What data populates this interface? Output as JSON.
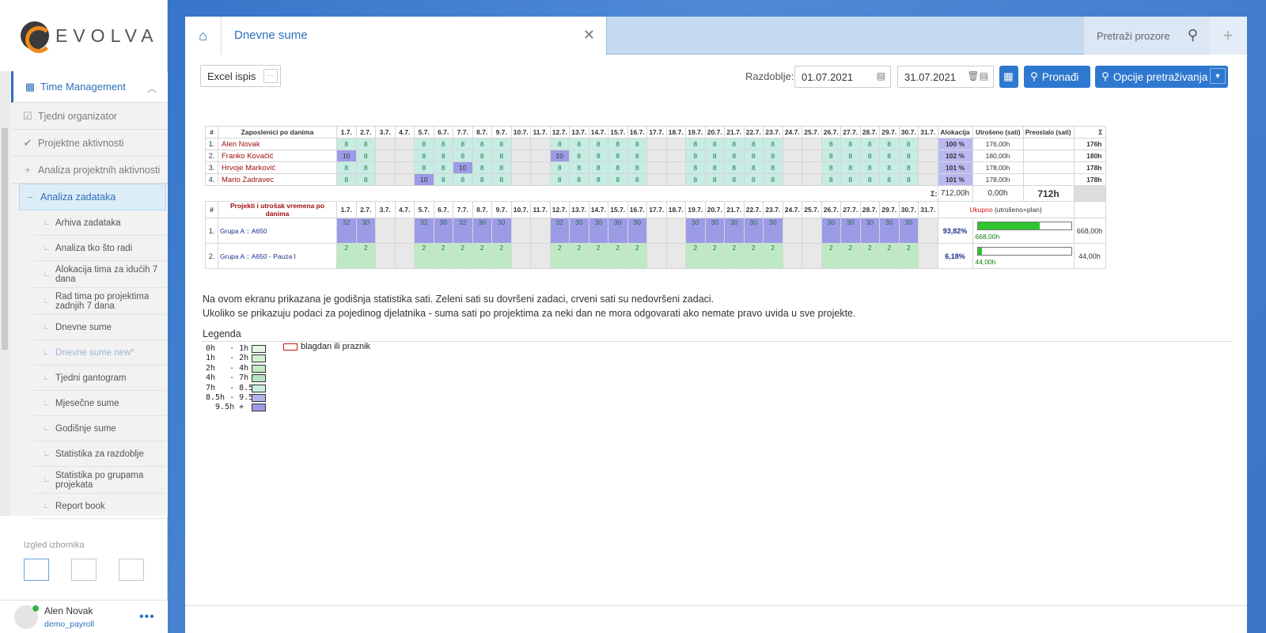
{
  "brand": {
    "name": "EVOLVA"
  },
  "colors": {
    "accent": "#2e6fbd",
    "cell_green": "#c6ece3",
    "cell_purple": "#9b9be6",
    "cell_weekend": "#e8e8e8",
    "cell_project_green": "#bfe9c4"
  },
  "sidebar": {
    "module": "Time Management",
    "items": [
      {
        "label": "Tjedni organizator",
        "icon": "calendar-check-icon"
      },
      {
        "label": "Projektne aktivnosti",
        "icon": "checkmark-icon"
      },
      {
        "label": "Analiza projektnih aktivnosti",
        "icon": "plus-icon"
      },
      {
        "label": "Analiza zadataka",
        "icon": "minus-icon"
      }
    ],
    "subitems": [
      "Arhiva zadataka",
      "Analiza tko što radi",
      "Alokacija tima za idućih 7 dana",
      "Rad tima po projektima zadnjih 7 dana",
      "Dnevne sume",
      "Dnevne sume new*",
      "Tjedni gantogram",
      "Mjesečne sume",
      "Godišnje sume",
      "Statistika za razdoblje",
      "Statistika po grupama projekata",
      "Report book"
    ],
    "layout_label": "Izgled izbornika"
  },
  "user": {
    "name": "Alen Novak",
    "role": "demo_payroll"
  },
  "tabs": {
    "active": "Dnevne sume",
    "search_placeholder": "Pretraži prozore"
  },
  "toolbar": {
    "excel": "Excel ispis",
    "period_label": "Razdoblje:",
    "date_from": "01.07.2021",
    "date_to": "31.07.2021",
    "find": "Pronađi",
    "options": "Opcije pretraživanja"
  },
  "grid": {
    "days": [
      "1.7.",
      "2.7.",
      "3.7.",
      "4.7.",
      "5.7.",
      "6.7.",
      "7.7.",
      "8.7.",
      "9.7.",
      "10.7.",
      "11.7.",
      "12.7.",
      "13.7.",
      "14.7.",
      "15.7.",
      "16.7.",
      "17.7.",
      "18.7.",
      "19.7.",
      "20.7.",
      "21.7.",
      "22.7.",
      "23.7.",
      "24.7.",
      "25.7.",
      "26.7.",
      "27.7.",
      "28.7.",
      "29.7.",
      "30.7.",
      "31.7."
    ],
    "hash": "#",
    "emp_header": "Zaposlenici po danima",
    "alloc_header": "Alokacija",
    "spent_header": "Utrošeno (sati)",
    "remain_header": "Preostalo (sati)",
    "sigma": "Σ",
    "employees": [
      {
        "n": "1.",
        "name": "Alen Novak",
        "hours": [
          "8",
          "8",
          "",
          "",
          "8",
          "8",
          "8",
          "8",
          "8",
          "",
          "",
          "8",
          "8",
          "8",
          "8",
          "8",
          "",
          "",
          "8",
          "8",
          "8",
          "8",
          "8",
          "",
          "",
          "8",
          "8",
          "8",
          "8",
          "8",
          ""
        ],
        "alloc": "100 %",
        "spent": "176,00h",
        "remain": "",
        "total": "176h"
      },
      {
        "n": "2.",
        "name": "Franko Kovačić",
        "hours": [
          "10",
          "8",
          "",
          "",
          "8",
          "8",
          "8",
          "8",
          "8",
          "",
          "",
          "10",
          "8",
          "8",
          "8",
          "8",
          "",
          "",
          "8",
          "8",
          "8",
          "8",
          "8",
          "",
          "",
          "8",
          "8",
          "8",
          "8",
          "8",
          ""
        ],
        "alloc": "102 %",
        "spent": "180,00h",
        "remain": "",
        "total": "180h"
      },
      {
        "n": "3.",
        "name": "Hrvoje Marković",
        "hours": [
          "8",
          "8",
          "",
          "",
          "8",
          "8",
          "10",
          "8",
          "8",
          "",
          "",
          "8",
          "8",
          "8",
          "8",
          "8",
          "",
          "",
          "8",
          "8",
          "8",
          "8",
          "8",
          "",
          "",
          "8",
          "8",
          "8",
          "8",
          "8",
          ""
        ],
        "alloc": "101 %",
        "spent": "178,00h",
        "remain": "",
        "total": "178h"
      },
      {
        "n": "4.",
        "name": "Mario Zadravec",
        "hours": [
          "8",
          "8",
          "",
          "",
          "10",
          "8",
          "8",
          "8",
          "8",
          "",
          "",
          "8",
          "8",
          "8",
          "8",
          "8",
          "",
          "",
          "8",
          "8",
          "8",
          "8",
          "8",
          "",
          "",
          "8",
          "8",
          "8",
          "8",
          "8",
          ""
        ],
        "alloc": "101 %",
        "spent": "178,00h",
        "remain": "",
        "total": "178h"
      }
    ],
    "sum_label": "Σ:",
    "sum_spent": "712,00h",
    "sum_remain": "0,00h",
    "sum_total": "712h",
    "proj_header": "Projekti i utrošak vremena po danima",
    "proj_total_red": "Ukupno",
    "proj_total_rest": "(utrošeno+plan)",
    "projects": [
      {
        "n": "1.",
        "name": "Grupa A :: A650",
        "hours": [
          "32",
          "30",
          "",
          "",
          "32",
          "30",
          "32",
          "30",
          "30",
          "",
          "",
          "32",
          "30",
          "30",
          "30",
          "30",
          "",
          "",
          "30",
          "30",
          "30",
          "30",
          "30",
          "",
          "",
          "30",
          "30",
          "30",
          "30",
          "30",
          ""
        ],
        "pct": "93,82%",
        "bar": 0.667,
        "bar_label": "668,00h",
        "total": "668,00h"
      },
      {
        "n": "2.",
        "name": "Grupa A :: A650 - Pauza I",
        "hours": [
          "2",
          "2",
          "",
          "",
          "2",
          "2",
          "2",
          "2",
          "2",
          "",
          "",
          "2",
          "2",
          "2",
          "2",
          "2",
          "",
          "",
          "2",
          "2",
          "2",
          "2",
          "2",
          "",
          "",
          "2",
          "2",
          "2",
          "2",
          "2",
          ""
        ],
        "pct": "6,18%",
        "bar": 0.044,
        "bar_label": "44,00h",
        "total": "44,00h"
      }
    ]
  },
  "description": {
    "line1": "Na ovom ekranu prikazana je godišnja statistika sati. Zeleni sati su dovršeni zadaci, crveni sati su nedovršeni zadaci.",
    "line2": "Ukoliko se prikazuju podaci za pojedinog djelatnika - suma sati po projektima za neki dan ne mora odgovarati ako nemate pravo uvida u sve projekte."
  },
  "legend": {
    "title": "Legenda",
    "rows": [
      "0h   - 1h",
      "1h   - 2h",
      "2h   - 4h",
      "4h   - 7h",
      "7h   - 8.5h",
      "8.5h - 9.5h",
      "  9.5h +"
    ],
    "colors": [
      "#e4f5e4",
      "#d4efd4",
      "#c4e9c4",
      "#b6e3c2",
      "#c6ece3",
      "#b3b3ec",
      "#9b9be6"
    ],
    "holiday": "blagdan ili praznik"
  }
}
